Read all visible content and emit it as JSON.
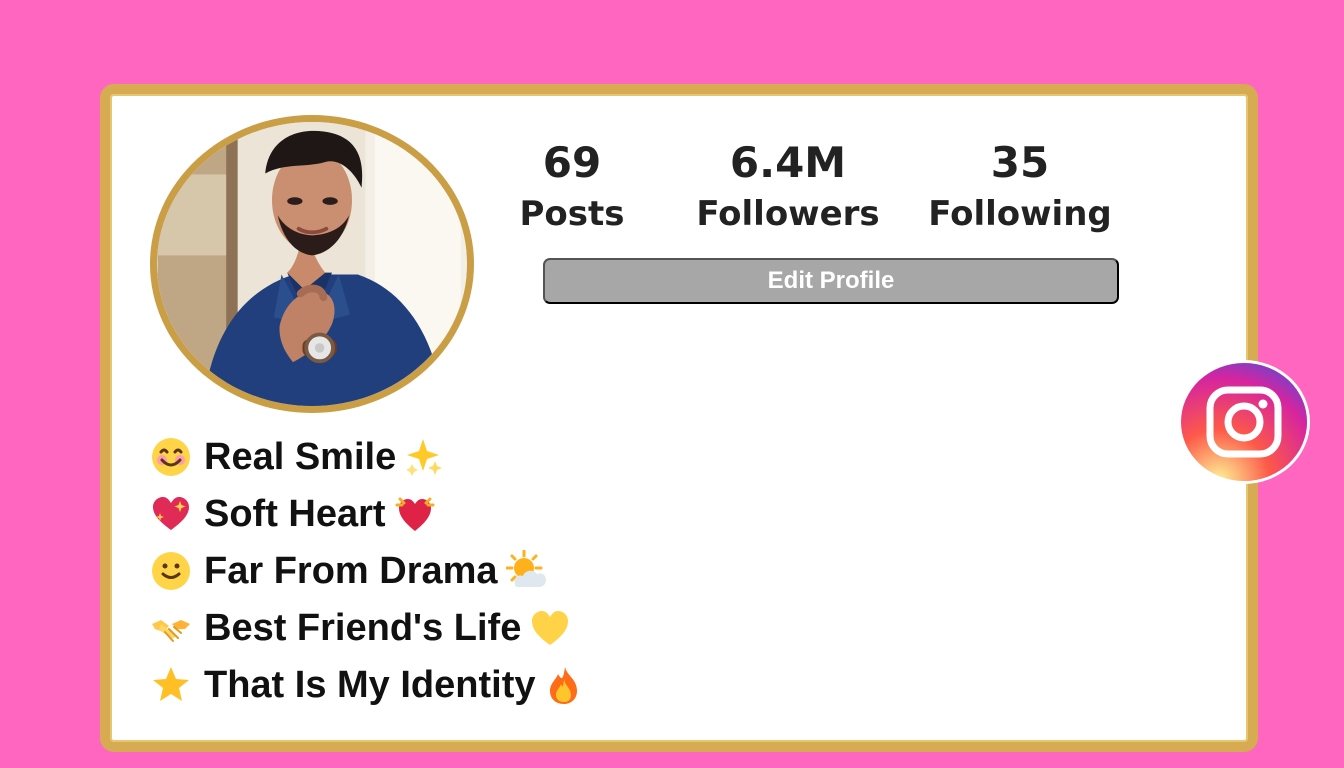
{
  "profile": {
    "stats": [
      {
        "value": "69",
        "label": "Posts"
      },
      {
        "value": "6.4M",
        "label": "Followers"
      },
      {
        "value": "35",
        "label": "Following"
      }
    ],
    "edit_button_label": "Edit Profile",
    "avatar_alt": "profile photo",
    "bio_lines": [
      {
        "text": "Real Smile",
        "left_icon": "smiling-face-icon",
        "right_icon": "sparkles-icon"
      },
      {
        "text": "Soft Heart",
        "left_icon": "sparkling-heart-icon",
        "right_icon": "beating-heart-icon"
      },
      {
        "text": "Far From Drama",
        "left_icon": "slight-smile-icon",
        "right_icon": "sun-behind-cloud-icon"
      },
      {
        "text": "Best Friend's Life",
        "left_icon": "handshake-icon",
        "right_icon": "yellow-heart-icon"
      },
      {
        "text": "That Is My Identity",
        "left_icon": "star-icon",
        "right_icon": "fire-icon"
      }
    ]
  },
  "branding": {
    "logo_icon": "instagram-logo-icon"
  },
  "colors": {
    "background": "#ff66bf",
    "frame": "#d7ab52",
    "button_background": "#a7a7a7",
    "button_text": "#ffffff"
  }
}
